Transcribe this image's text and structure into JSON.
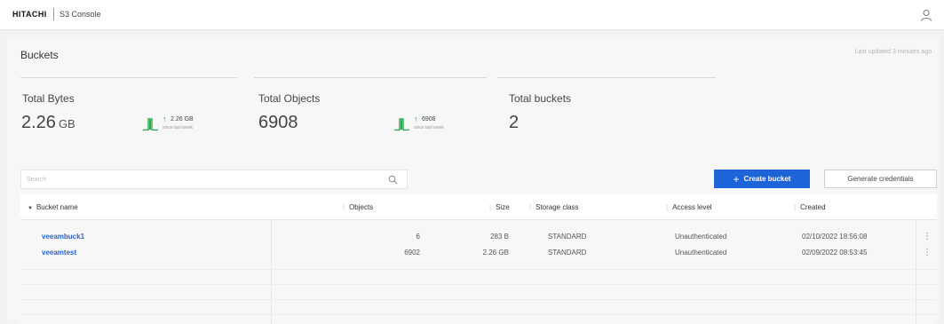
{
  "header": {
    "brand": "HITACHI",
    "app_name": "S3 Console",
    "user_icon": "user-icon"
  },
  "buckets_page": {
    "title": "Buckets",
    "last_updated": "Last updated 3 minutes ago"
  },
  "summary": {
    "total_bytes": {
      "label": "Total Bytes",
      "value": "2.26",
      "unit": "GB",
      "trend_value": "2.26 GB",
      "trend_period": "since last week"
    },
    "total_objects": {
      "label": "Total Objects",
      "value": "6908",
      "trend_value": "6908",
      "trend_period": "since last week"
    },
    "total_buckets": {
      "label": "Total buckets",
      "value": "2"
    }
  },
  "toolbar": {
    "search_placeholder": "Search",
    "create_bucket_label": "Create bucket",
    "generate_credentials_label": "Generate credentials"
  },
  "table": {
    "columns": {
      "bucket_name": "Bucket name",
      "objects": "Objects",
      "size": "Size",
      "storage_class": "Storage class",
      "access_level": "Access level",
      "created": "Created"
    },
    "rows": [
      {
        "bucket_name": "veeambuck1",
        "objects": "6",
        "size": "283 B",
        "storage_class": "STANDARD",
        "access_level": "Unauthenticated",
        "created": "02/10/2022 18:56:08"
      },
      {
        "bucket_name": "veeamtest",
        "objects": "6902",
        "size": "2.26 GB",
        "storage_class": "STANDARD",
        "access_level": "Unauthenticated",
        "created": "02/09/2022 08:53:45"
      }
    ]
  },
  "colors": {
    "accent": "#1c64d8",
    "link": "#2a63c9",
    "trend_up": "#2aa84a"
  }
}
